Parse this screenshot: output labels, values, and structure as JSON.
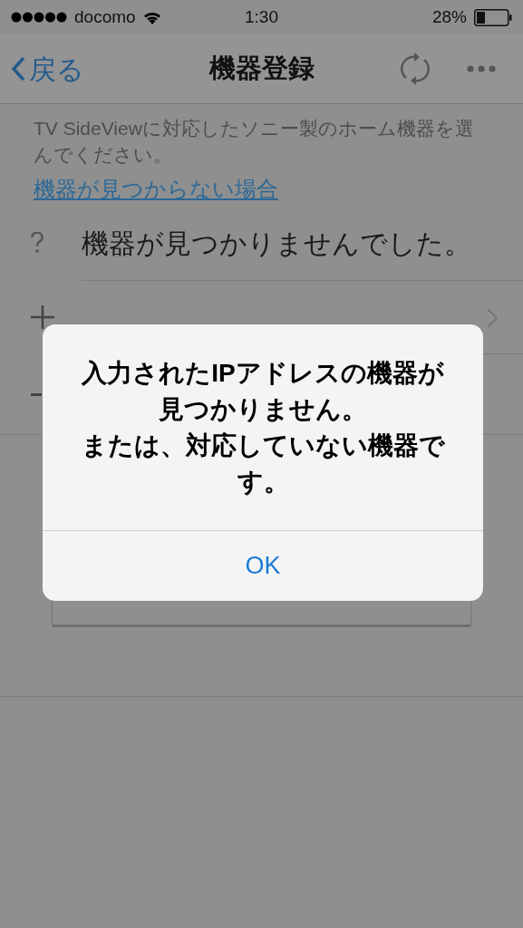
{
  "status_bar": {
    "carrier": "docomo",
    "time": "1:30",
    "battery": "28%"
  },
  "nav": {
    "back": "戻る",
    "title": "機器登録"
  },
  "description": "TV SideViewに対応したソニー製のホーム機器を選んでください。",
  "help_link": "機器が見つからない場合",
  "rows": [
    {
      "kind": "message",
      "text": "機器が見つかりませんでした。"
    },
    {
      "kind": "add"
    },
    {
      "kind": "remove"
    }
  ],
  "dialog": {
    "lines": [
      "入力されたIPアドレスの機器が",
      "見つかりません。",
      "または、対応していない機器で",
      "す。"
    ],
    "button": "OK"
  }
}
